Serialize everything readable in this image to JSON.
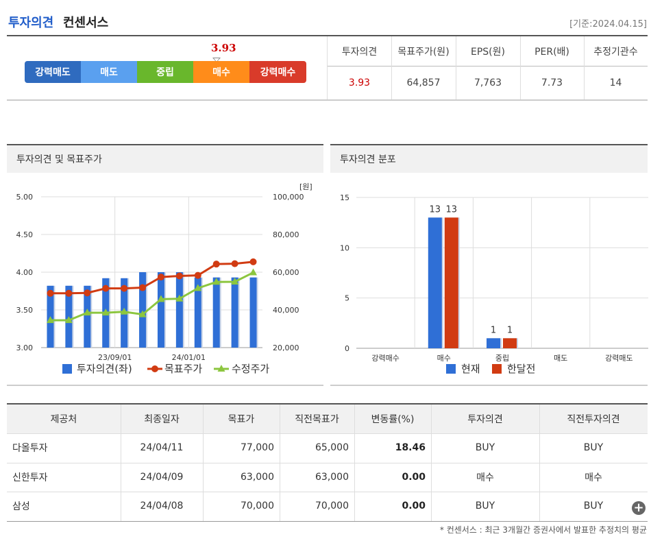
{
  "header": {
    "title_highlight": "투자의견",
    "title_rest": "컨센서스",
    "base_date": "[기준:2024.04.15]"
  },
  "rating_bar": {
    "value": "3.93",
    "segments": [
      {
        "label": "강력매도",
        "color": "#2f6bbf"
      },
      {
        "label": "매도",
        "color": "#5aa0ef"
      },
      {
        "label": "중립",
        "color": "#69b72c"
      },
      {
        "label": "매수",
        "color": "#ff8c1a"
      },
      {
        "label": "강력매수",
        "color": "#d93b2a"
      }
    ]
  },
  "summary": {
    "headers": [
      "투자의견",
      "목표주가(원)",
      "EPS(원)",
      "PER(배)",
      "추정기관수"
    ],
    "values": [
      "3.93",
      "64,857",
      "7,763",
      "7.73",
      "14"
    ]
  },
  "panels": {
    "left_title": "투자의견 및 목표주가",
    "right_title": "투자의견 분포"
  },
  "chart_data": [
    {
      "type": "bar",
      "title": "투자의견 및 목표주가",
      "y_left_ticks": [
        "5.00",
        "4.50",
        "4.00",
        "3.50",
        "3.00"
      ],
      "y_left_range": [
        3.0,
        5.0
      ],
      "y_right_unit": "[원]",
      "y_right_ticks": [
        "100,000",
        "80,000",
        "60,000",
        "40,000",
        "20,000"
      ],
      "y_right_range": [
        20000,
        100000
      ],
      "x_tick_labels": [
        {
          "label": "23/09/01",
          "index": 3.5
        },
        {
          "label": "24/01/01",
          "index": 7.5
        }
      ],
      "series": [
        {
          "name": "투자의견(좌)",
          "kind": "bar",
          "color": "#2f6fd6",
          "values": [
            3.82,
            3.82,
            3.82,
            3.92,
            3.92,
            4.0,
            4.0,
            4.0,
            3.93,
            3.93,
            3.93,
            3.93
          ]
        },
        {
          "name": "목표주가",
          "kind": "line",
          "color": "#d13b12",
          "marker": "circle",
          "values": [
            48800,
            48800,
            49000,
            51400,
            51400,
            51800,
            57400,
            58000,
            58300,
            64300,
            64500,
            65500
          ]
        },
        {
          "name": "수정주가",
          "kind": "line",
          "color": "#8cc63f",
          "marker": "triangle",
          "values": [
            34500,
            34500,
            38500,
            38500,
            39000,
            37600,
            45700,
            45900,
            51500,
            54800,
            54900,
            59800
          ]
        }
      ],
      "grid": true,
      "legend": "bottom"
    },
    {
      "type": "bar",
      "title": "투자의견 분포",
      "categories": [
        "강력매수",
        "매수",
        "중립",
        "매도",
        "강력매도"
      ],
      "y_ticks": [
        "15",
        "10",
        "5",
        "0"
      ],
      "ylim": [
        0,
        15
      ],
      "series": [
        {
          "name": "현재",
          "color": "#2f6fd6",
          "values": [
            0,
            13,
            1,
            0,
            0
          ]
        },
        {
          "name": "한달전",
          "color": "#d13b12",
          "values": [
            0,
            13,
            1,
            0,
            0
          ]
        }
      ],
      "data_labels": {
        "현재": [
          "",
          "13",
          "1",
          "",
          ""
        ],
        "한달전": [
          "",
          "13",
          "1",
          "",
          ""
        ]
      },
      "grid": true,
      "legend": "bottom"
    }
  ],
  "providers": {
    "headers": [
      "제공처",
      "최종일자",
      "목표가",
      "직전목표가",
      "변동률(%)",
      "투자의견",
      "직전투자의견"
    ],
    "rows": [
      [
        "다올투자",
        "24/04/11",
        "77,000",
        "65,000",
        "18.46",
        "BUY",
        "BUY"
      ],
      [
        "신한투자",
        "24/04/09",
        "63,000",
        "63,000",
        "0.00",
        "매수",
        "매수"
      ],
      [
        "삼성",
        "24/04/08",
        "70,000",
        "70,000",
        "0.00",
        "BUY",
        "BUY"
      ]
    ]
  },
  "footnote": "* 컨센서스 : 최근 3개월간 증권사에서 발표한 추정치의 평균"
}
